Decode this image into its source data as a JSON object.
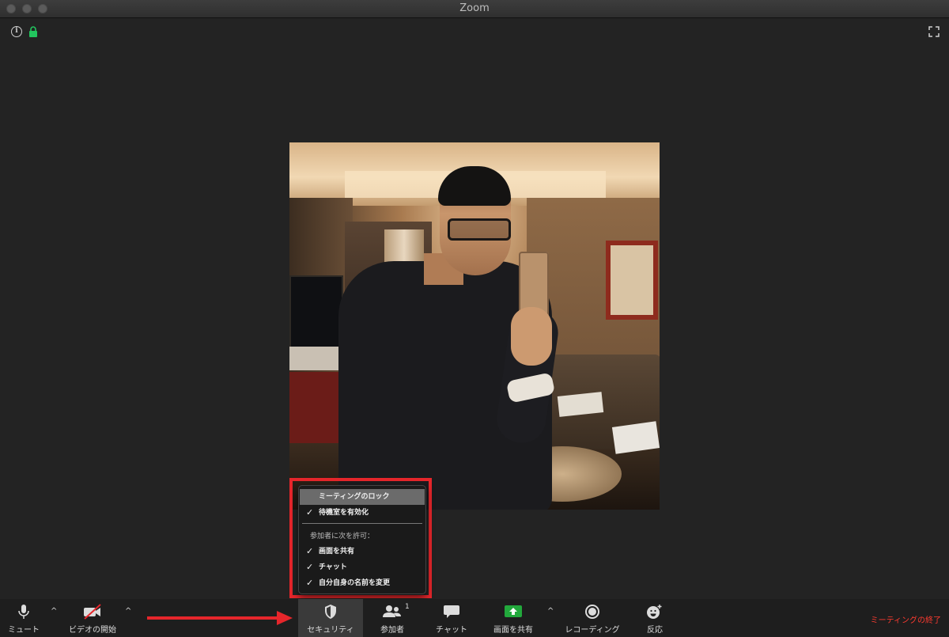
{
  "window": {
    "title": "Zoom"
  },
  "colors": {
    "accent_red": "#e6262b",
    "end_meeting": "#ff3b30",
    "share_green": "#22a93c",
    "lock_green": "#22c55e"
  },
  "security_menu": {
    "lock_meeting": "ミーティングのロック",
    "enable_waiting_room": "待機室を有効化",
    "allow_header": "参加者に次を許可：",
    "share_screen": "画面を共有",
    "chat": "チャット",
    "rename_self": "自分自身の名前を変更",
    "check_mark": "✓"
  },
  "toolbar": {
    "mute": "ミュート",
    "start_video": "ビデオの開始",
    "security": "セキュリティ",
    "participants": "参加者",
    "participants_count": "1",
    "chat": "チャット",
    "share_screen": "画面を共有",
    "recording": "レコーディング",
    "reactions": "反応",
    "end_meeting": "ミーティングの終了",
    "caret": "^"
  }
}
